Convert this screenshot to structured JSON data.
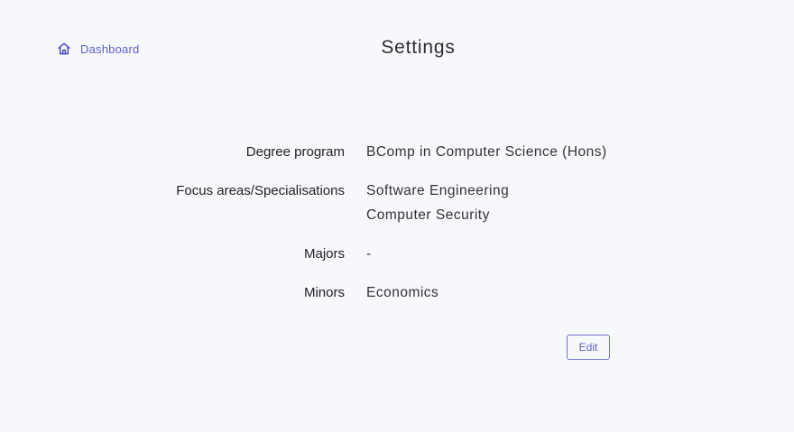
{
  "nav": {
    "dashboard_label": "Dashboard",
    "icon": "home-icon"
  },
  "page": {
    "title": "Settings"
  },
  "settings": {
    "degree_program": {
      "label": "Degree program",
      "value": "BComp in Computer Science (Hons)"
    },
    "focus_areas": {
      "label": "Focus areas/Specialisations",
      "values": [
        "Software Engineering",
        "Computer Security"
      ]
    },
    "majors": {
      "label": "Majors",
      "value": "-"
    },
    "minors": {
      "label": "Minors",
      "value": "Economics"
    }
  },
  "actions": {
    "edit_label": "Edit"
  },
  "colors": {
    "background": "#f6f8fc",
    "accent": "#5c5fc7",
    "text": "#2b2b2b"
  }
}
